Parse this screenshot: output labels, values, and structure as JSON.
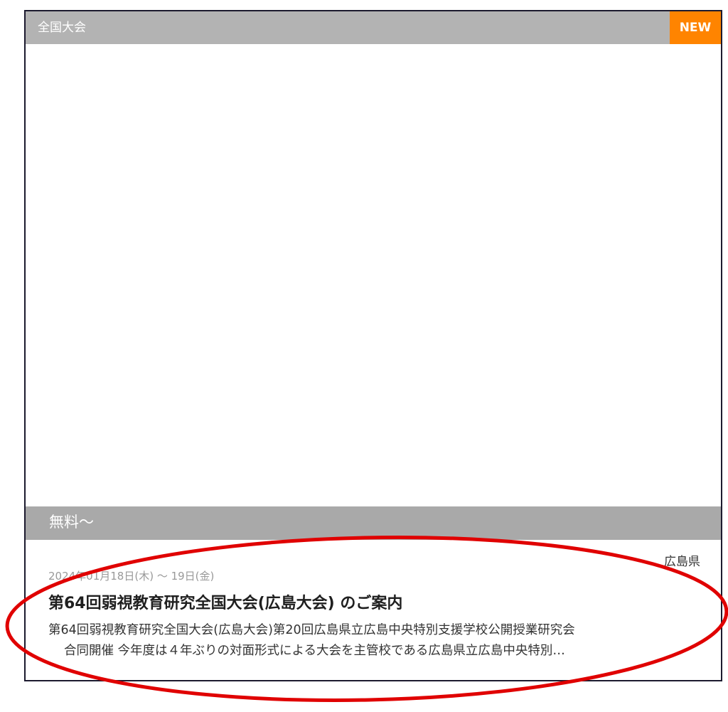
{
  "card": {
    "category": "全国大会",
    "badge": "NEW",
    "price": "無料〜",
    "region": "広島県",
    "date": "2024年01月18日(木) 〜 19日(金)",
    "title": "第64回弱視教育研究全国大会(広島大会) のご案内",
    "description_line1": "第64回弱視教育研究全国大会(広島大会)第20回広島県立広島中央特別支援学校公開授業研究会",
    "description_line2": "合同開催 今年度は４年ぶりの対面形式による大会を主管校である広島県立広島中央特別…"
  },
  "colors": {
    "header_bar": "#b3b3b3",
    "badge": "#ff8400",
    "price_bar": "#a9a9a9",
    "card_border": "#1c1a2e",
    "highlight_ellipse": "#e00000"
  }
}
